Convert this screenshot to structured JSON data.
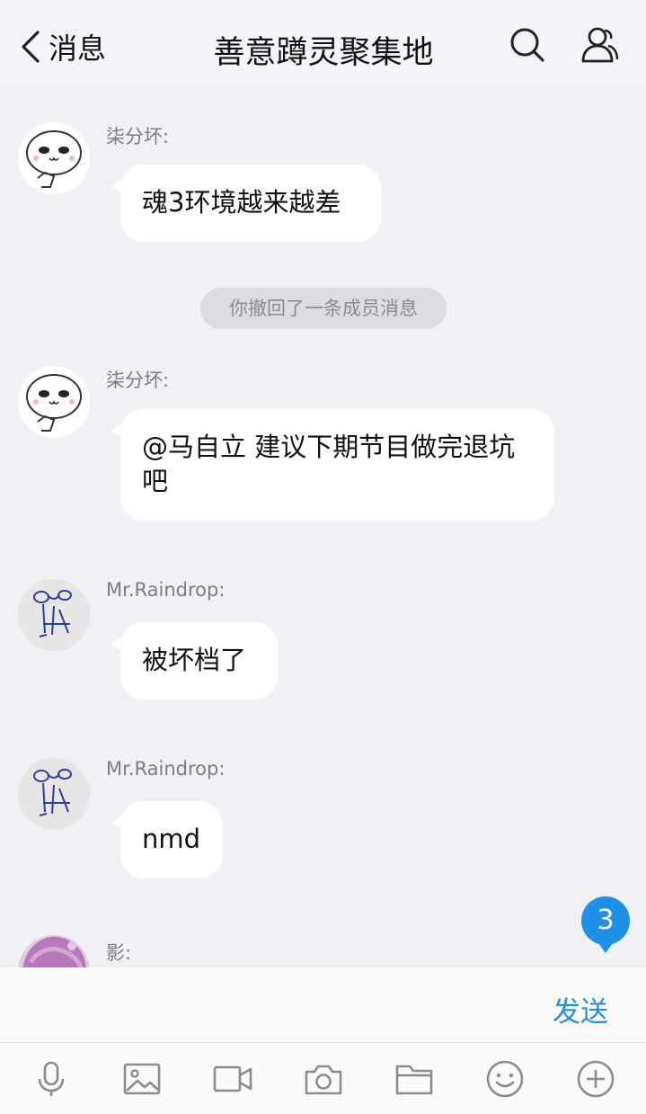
{
  "header": {
    "back_label": "消息",
    "title": "善意蹲灵聚集地"
  },
  "messages": [
    {
      "sender": "柒分坏:",
      "text": "魂3环境越来越差",
      "avatar": "cartoon-face"
    },
    {
      "sender": "柒分坏:",
      "text": "@马自立 建议下期节目做完退坑吧",
      "avatar": "cartoon-face"
    },
    {
      "sender": "Mr.Raindrop:",
      "text": "被坏档了",
      "avatar": "doodle-dog"
    },
    {
      "sender": "Mr.Raindrop:",
      "text": "nmd",
      "avatar": "doodle-dog"
    },
    {
      "sender": "影:",
      "avatar": "anime-girl"
    }
  ],
  "system_notice": "你撤回了一条成员消息",
  "unread_count": "3",
  "input": {
    "send_label": "发送"
  },
  "toolbar_icons": [
    "microphone-icon",
    "image-icon",
    "video-icon",
    "camera-icon",
    "folder-icon",
    "emoji-icon",
    "plus-icon"
  ],
  "colors": {
    "accent": "#2b8cd8",
    "badge": "#1e90e8",
    "background": "#f0f1f5"
  }
}
